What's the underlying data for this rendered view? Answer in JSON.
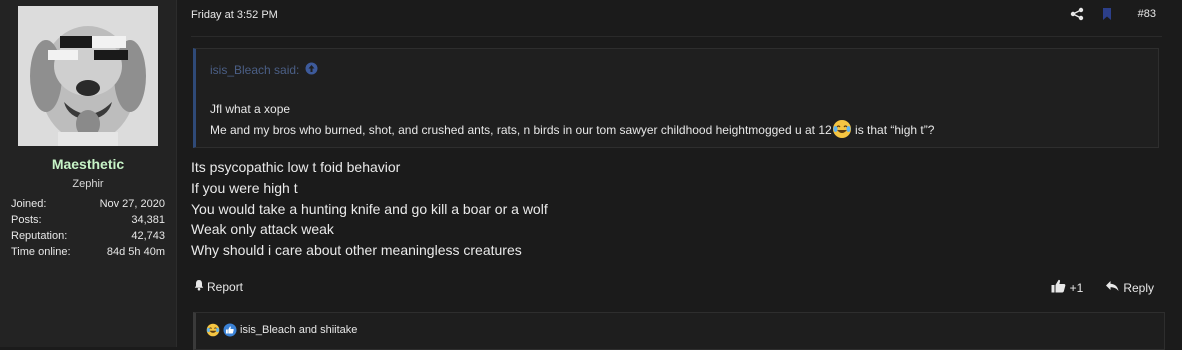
{
  "user": {
    "username": "Maesthetic",
    "title": "Zephir",
    "stats": [
      {
        "label": "Joined:",
        "value": "Nov 27, 2020"
      },
      {
        "label": "Posts:",
        "value": "34,381"
      },
      {
        "label": "Reputation:",
        "value": "42,743"
      },
      {
        "label": "Time online:",
        "value": "84d 5h 40m"
      }
    ]
  },
  "post": {
    "date": "Friday at 3:52 PM",
    "number": "#83",
    "quote": {
      "author_said": "isis_Bleach said:",
      "line1": "Jfl what a xope",
      "line2_before": "Me and my bros who burned, shot, and crushed ants, rats, n birds in our tom sawyer childhood heightmogged u at 12",
      "line2_after": " is that “high t”?"
    },
    "body_lines": [
      "Its psycopathic low t foid behavior",
      "If you were high t",
      "You would take a hunting knife and go kill a boar or a wolf",
      "Weak only attack weak",
      "Why should i care about other meaningless creatures"
    ],
    "report_label": "Report",
    "like_count": "+1",
    "reply_label": "Reply",
    "reactions_text": "isis_Bleach and shiitake"
  },
  "colors": {
    "background": "#1b1b1b",
    "sidebar": "#232323",
    "username": "#c6f3c6",
    "quote_accent": "#2f4a78",
    "quote_author": "#4b5f86"
  },
  "icons": [
    "share-icon",
    "bookmark-icon",
    "arrow-up-circle-icon",
    "crying-laughing-emoji",
    "bell-icon",
    "thumbs-up-icon",
    "reply-icon",
    "like-reaction-icon"
  ]
}
